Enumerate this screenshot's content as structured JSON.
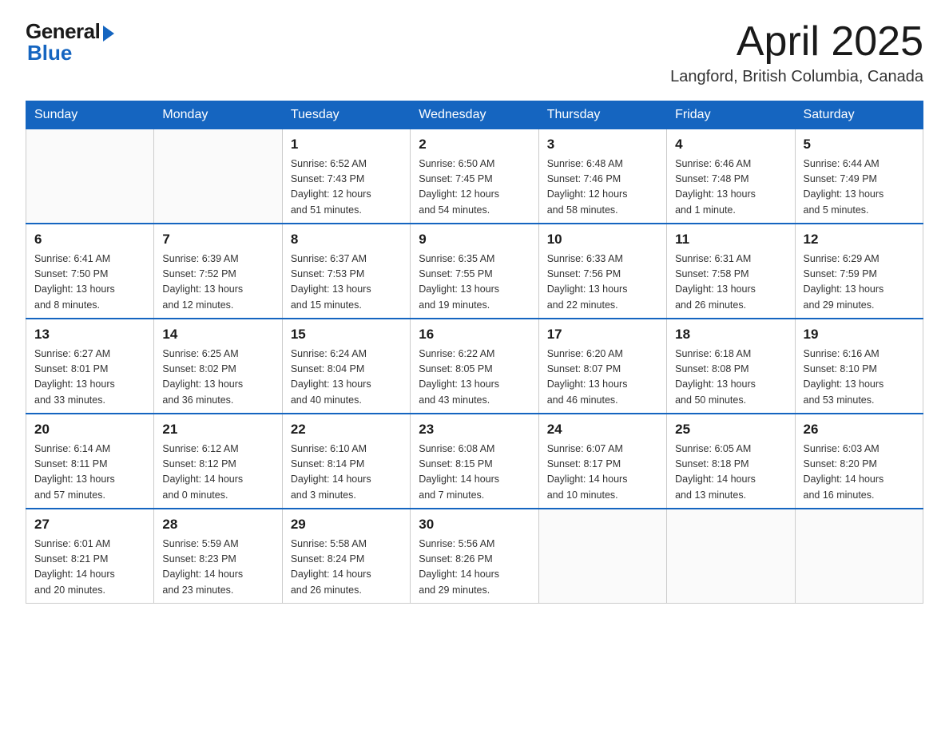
{
  "logo": {
    "general": "General",
    "blue": "Blue"
  },
  "header": {
    "month": "April 2025",
    "location": "Langford, British Columbia, Canada"
  },
  "weekdays": [
    "Sunday",
    "Monday",
    "Tuesday",
    "Wednesday",
    "Thursday",
    "Friday",
    "Saturday"
  ],
  "weeks": [
    [
      {
        "day": "",
        "info": ""
      },
      {
        "day": "",
        "info": ""
      },
      {
        "day": "1",
        "info": "Sunrise: 6:52 AM\nSunset: 7:43 PM\nDaylight: 12 hours\nand 51 minutes."
      },
      {
        "day": "2",
        "info": "Sunrise: 6:50 AM\nSunset: 7:45 PM\nDaylight: 12 hours\nand 54 minutes."
      },
      {
        "day": "3",
        "info": "Sunrise: 6:48 AM\nSunset: 7:46 PM\nDaylight: 12 hours\nand 58 minutes."
      },
      {
        "day": "4",
        "info": "Sunrise: 6:46 AM\nSunset: 7:48 PM\nDaylight: 13 hours\nand 1 minute."
      },
      {
        "day": "5",
        "info": "Sunrise: 6:44 AM\nSunset: 7:49 PM\nDaylight: 13 hours\nand 5 minutes."
      }
    ],
    [
      {
        "day": "6",
        "info": "Sunrise: 6:41 AM\nSunset: 7:50 PM\nDaylight: 13 hours\nand 8 minutes."
      },
      {
        "day": "7",
        "info": "Sunrise: 6:39 AM\nSunset: 7:52 PM\nDaylight: 13 hours\nand 12 minutes."
      },
      {
        "day": "8",
        "info": "Sunrise: 6:37 AM\nSunset: 7:53 PM\nDaylight: 13 hours\nand 15 minutes."
      },
      {
        "day": "9",
        "info": "Sunrise: 6:35 AM\nSunset: 7:55 PM\nDaylight: 13 hours\nand 19 minutes."
      },
      {
        "day": "10",
        "info": "Sunrise: 6:33 AM\nSunset: 7:56 PM\nDaylight: 13 hours\nand 22 minutes."
      },
      {
        "day": "11",
        "info": "Sunrise: 6:31 AM\nSunset: 7:58 PM\nDaylight: 13 hours\nand 26 minutes."
      },
      {
        "day": "12",
        "info": "Sunrise: 6:29 AM\nSunset: 7:59 PM\nDaylight: 13 hours\nand 29 minutes."
      }
    ],
    [
      {
        "day": "13",
        "info": "Sunrise: 6:27 AM\nSunset: 8:01 PM\nDaylight: 13 hours\nand 33 minutes."
      },
      {
        "day": "14",
        "info": "Sunrise: 6:25 AM\nSunset: 8:02 PM\nDaylight: 13 hours\nand 36 minutes."
      },
      {
        "day": "15",
        "info": "Sunrise: 6:24 AM\nSunset: 8:04 PM\nDaylight: 13 hours\nand 40 minutes."
      },
      {
        "day": "16",
        "info": "Sunrise: 6:22 AM\nSunset: 8:05 PM\nDaylight: 13 hours\nand 43 minutes."
      },
      {
        "day": "17",
        "info": "Sunrise: 6:20 AM\nSunset: 8:07 PM\nDaylight: 13 hours\nand 46 minutes."
      },
      {
        "day": "18",
        "info": "Sunrise: 6:18 AM\nSunset: 8:08 PM\nDaylight: 13 hours\nand 50 minutes."
      },
      {
        "day": "19",
        "info": "Sunrise: 6:16 AM\nSunset: 8:10 PM\nDaylight: 13 hours\nand 53 minutes."
      }
    ],
    [
      {
        "day": "20",
        "info": "Sunrise: 6:14 AM\nSunset: 8:11 PM\nDaylight: 13 hours\nand 57 minutes."
      },
      {
        "day": "21",
        "info": "Sunrise: 6:12 AM\nSunset: 8:12 PM\nDaylight: 14 hours\nand 0 minutes."
      },
      {
        "day": "22",
        "info": "Sunrise: 6:10 AM\nSunset: 8:14 PM\nDaylight: 14 hours\nand 3 minutes."
      },
      {
        "day": "23",
        "info": "Sunrise: 6:08 AM\nSunset: 8:15 PM\nDaylight: 14 hours\nand 7 minutes."
      },
      {
        "day": "24",
        "info": "Sunrise: 6:07 AM\nSunset: 8:17 PM\nDaylight: 14 hours\nand 10 minutes."
      },
      {
        "day": "25",
        "info": "Sunrise: 6:05 AM\nSunset: 8:18 PM\nDaylight: 14 hours\nand 13 minutes."
      },
      {
        "day": "26",
        "info": "Sunrise: 6:03 AM\nSunset: 8:20 PM\nDaylight: 14 hours\nand 16 minutes."
      }
    ],
    [
      {
        "day": "27",
        "info": "Sunrise: 6:01 AM\nSunset: 8:21 PM\nDaylight: 14 hours\nand 20 minutes."
      },
      {
        "day": "28",
        "info": "Sunrise: 5:59 AM\nSunset: 8:23 PM\nDaylight: 14 hours\nand 23 minutes."
      },
      {
        "day": "29",
        "info": "Sunrise: 5:58 AM\nSunset: 8:24 PM\nDaylight: 14 hours\nand 26 minutes."
      },
      {
        "day": "30",
        "info": "Sunrise: 5:56 AM\nSunset: 8:26 PM\nDaylight: 14 hours\nand 29 minutes."
      },
      {
        "day": "",
        "info": ""
      },
      {
        "day": "",
        "info": ""
      },
      {
        "day": "",
        "info": ""
      }
    ]
  ]
}
